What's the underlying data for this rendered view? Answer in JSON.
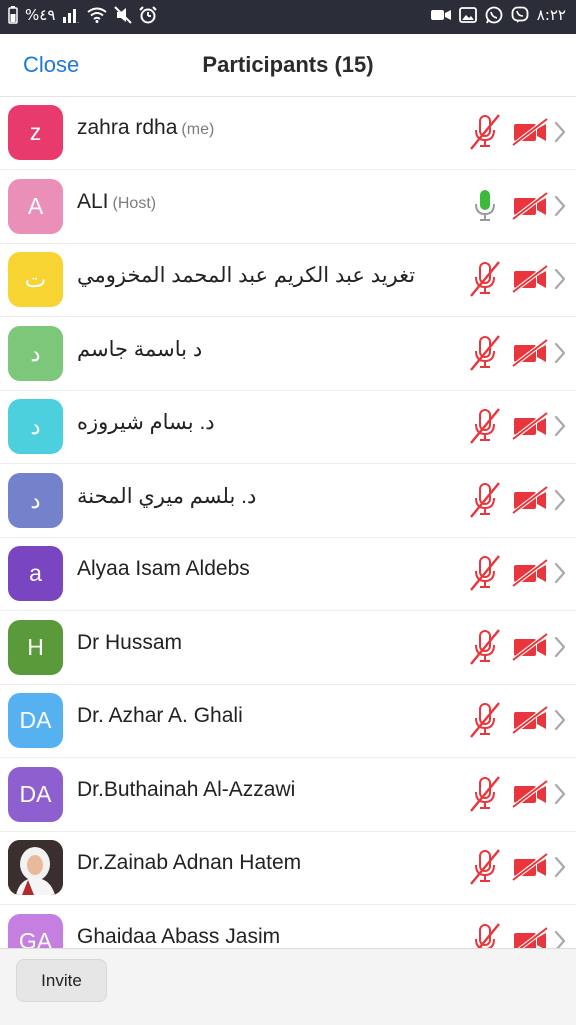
{
  "status_bar": {
    "left_text": "%٤٩",
    "time": "٨:٢٢",
    "left_icons": [
      "battery-icon",
      "signal-icon",
      "wifi-icon",
      "mute-icon",
      "alarm-icon"
    ],
    "right_icons": [
      "video-icon",
      "gallery-icon",
      "whatsapp-icon",
      "viber-icon"
    ]
  },
  "header": {
    "close_label": "Close",
    "title": "Participants (15)"
  },
  "colors": {
    "accent": "#1e78d6",
    "muted_red": "#e8363c",
    "unmuted_green": "#3cba3c",
    "status_bar_bg": "#2b2d38"
  },
  "participants": [
    {
      "initial": "z",
      "name": "zahra rdha",
      "role": "(me)",
      "avatar_color": "#e93a6e",
      "mic": "muted",
      "video": "off"
    },
    {
      "initial": "A",
      "name": "ALI",
      "role": "(Host)",
      "avatar_color": "#ea8fb8",
      "mic": "unmuted",
      "video": "off"
    },
    {
      "initial": "ت",
      "name": "تغريد عبد الكريم عبد المحمد المخزومي",
      "role": "",
      "avatar_color": "#f7d431",
      "mic": "muted",
      "video": "off"
    },
    {
      "initial": "د",
      "name": "د باسمة جاسم",
      "role": "",
      "avatar_color": "#7cc77a",
      "mic": "muted",
      "video": "off"
    },
    {
      "initial": "د",
      "name": "د. بسام شيروزه",
      "role": "",
      "avatar_color": "#4cd0de",
      "mic": "muted",
      "video": "off"
    },
    {
      "initial": "د",
      "name": "د. بلسم ميري المحنة",
      "role": "",
      "avatar_color": "#7482cc",
      "mic": "muted",
      "video": "off"
    },
    {
      "initial": "a",
      "name": "Alyaa Isam Aldebs",
      "role": "",
      "avatar_color": "#7a45c0",
      "mic": "muted",
      "video": "off"
    },
    {
      "initial": "H",
      "name": "Dr Hussam",
      "role": "",
      "avatar_color": "#5a9a3a",
      "mic": "muted",
      "video": "off"
    },
    {
      "initial": "DA",
      "name": "Dr. Azhar A. Ghali",
      "role": "",
      "avatar_color": "#55b1f0",
      "mic": "muted",
      "video": "off"
    },
    {
      "initial": "DA",
      "name": "Dr.Buthainah Al-Azzawi",
      "role": "",
      "avatar_color": "#8d5fcf",
      "mic": "muted",
      "video": "off"
    },
    {
      "initial": "",
      "name": "Dr.Zainab Adnan Hatem",
      "role": "",
      "avatar_color": "#2e2a2a",
      "avatar_type": "photo",
      "mic": "muted",
      "video": "off"
    },
    {
      "initial": "GA",
      "name": "Ghaidaa Abass Jasim",
      "role": "",
      "avatar_color": "#c47fe0",
      "mic": "muted",
      "video": "off"
    }
  ],
  "footer": {
    "invite_label": "Invite"
  }
}
